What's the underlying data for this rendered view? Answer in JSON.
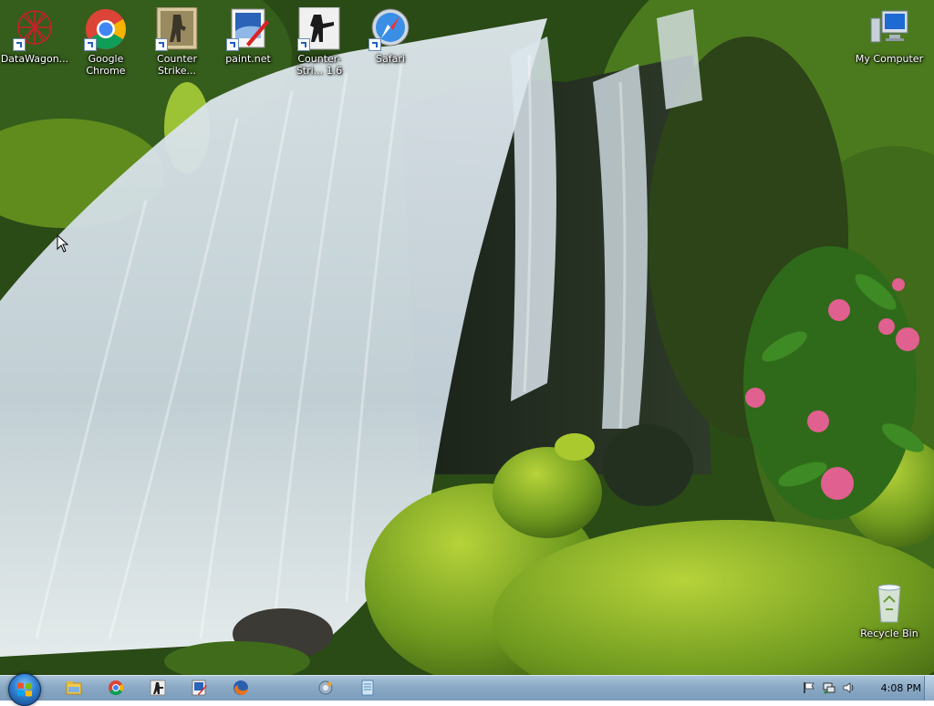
{
  "desktop": {
    "icons": [
      {
        "label": "DataWagon...",
        "icon": "datawagon-icon"
      },
      {
        "label": "Google Chrome",
        "icon": "chrome-icon"
      },
      {
        "label": "Counter Strike...",
        "icon": "counter-strike-icon"
      },
      {
        "label": "paint.net",
        "icon": "paintnet-icon"
      },
      {
        "label": "Counter-Stri... 1.6",
        "icon": "counter-strike-16-icon"
      },
      {
        "label": "Safari",
        "icon": "safari-icon"
      },
      {
        "label": "My Computer",
        "icon": "computer-icon"
      },
      {
        "label": "Recycle Bin",
        "icon": "recycle-bin-icon"
      }
    ]
  },
  "taskbar": {
    "start_icon": "windows-logo-icon",
    "pinned": [
      "explorer-icon",
      "chrome-icon",
      "counter-strike-icon",
      "paintnet-icon",
      "firefox-icon",
      "settings-icon",
      "notepad-icon"
    ],
    "tray": [
      "flag-icon",
      "network-icon",
      "volume-icon"
    ],
    "clock": "4:08 PM"
  }
}
